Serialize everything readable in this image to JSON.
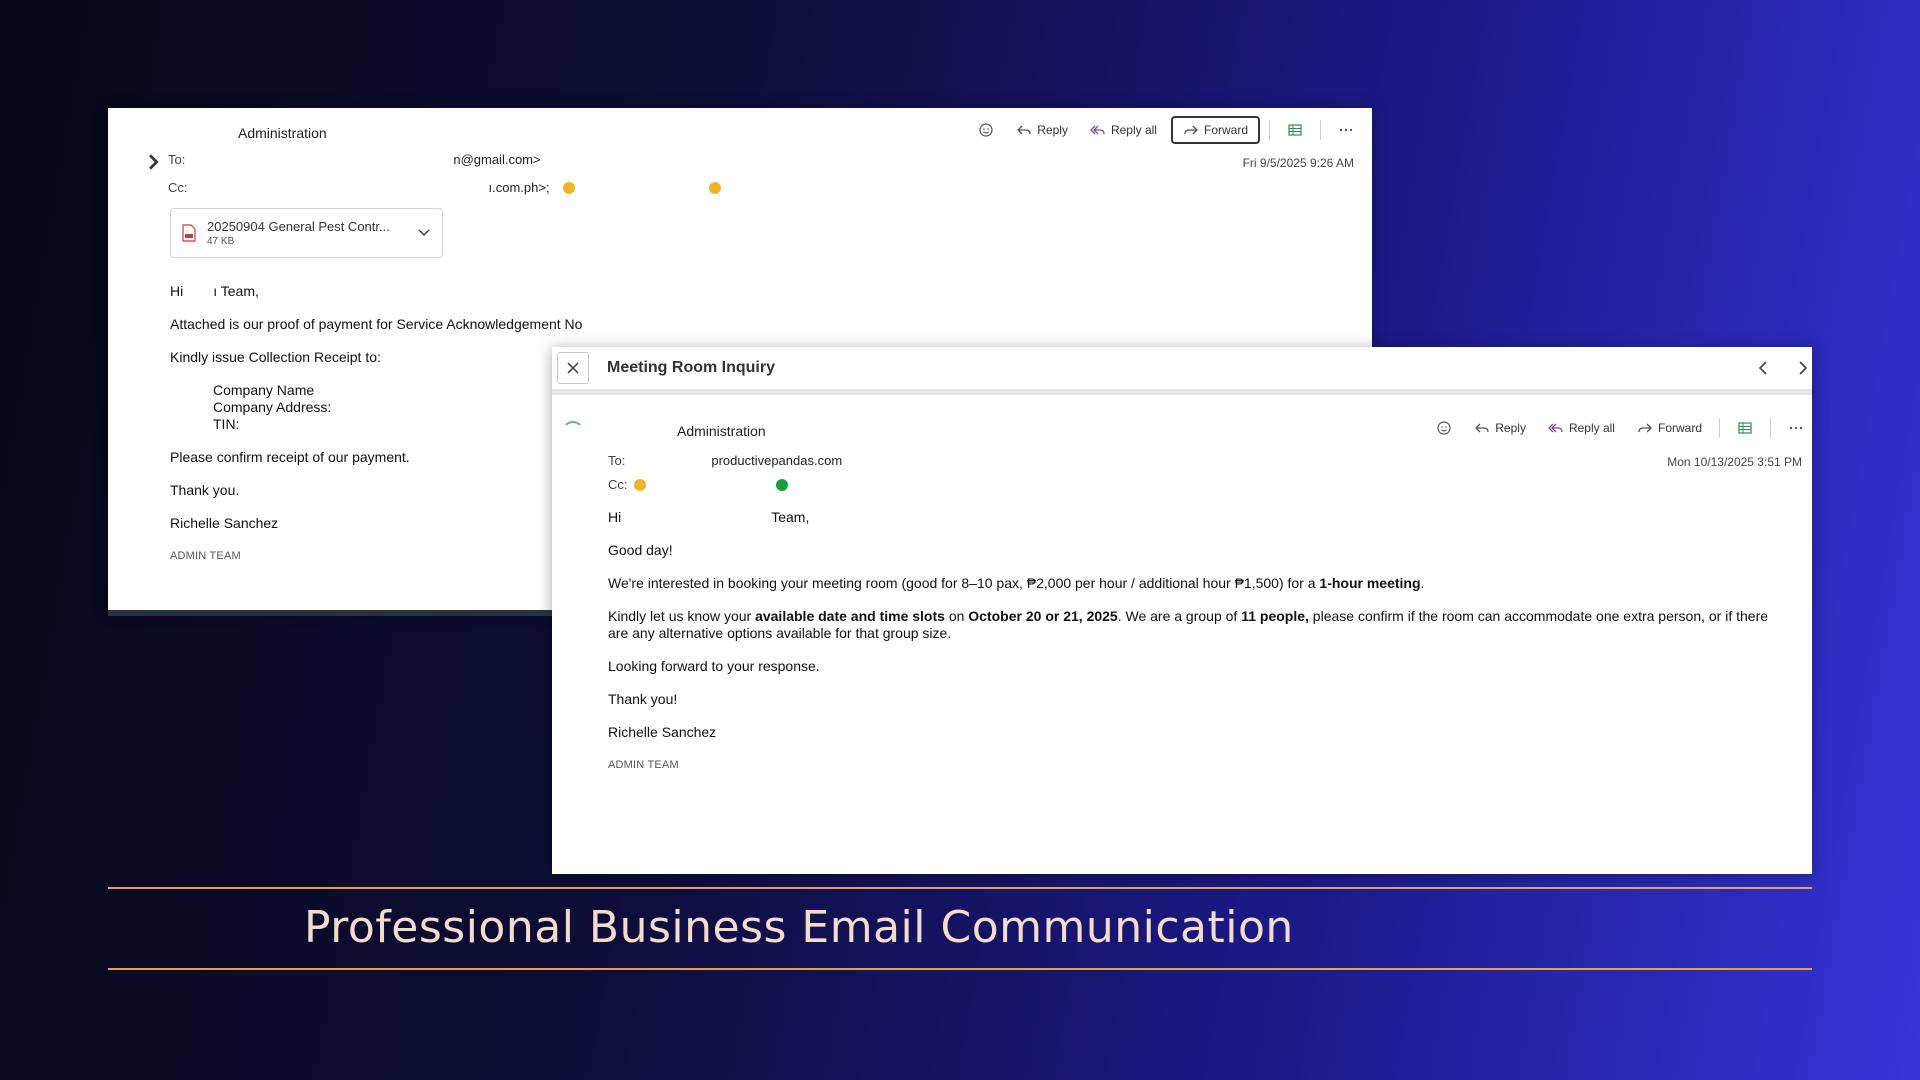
{
  "caption": "Professional Business Email Communication",
  "toolbar": {
    "reply": "Reply",
    "reply_all": "Reply all",
    "forward": "Forward",
    "icons": [
      "smiley-icon",
      "reply-icon",
      "reply-all-icon",
      "forward-icon",
      "table-icon",
      "more-icon"
    ]
  },
  "email1": {
    "sender": "Administration",
    "to_label": "To:",
    "to_value": "n@gmail.com>",
    "cc_label": "Cc:",
    "cc_value": "ı.com.ph>;",
    "timestamp": "Fri 9/5/2025 9:26 AM",
    "attachment": {
      "name": "20250904 General Pest Contr...",
      "size": "47 KB"
    },
    "body": {
      "greeting_pre": "Hi",
      "greeting_post": "ı Team,",
      "line1": "Attached is our proof of payment for Service Acknowledgement No",
      "line2": "Kindly issue Collection Receipt to:",
      "field_company_name": "Company Name",
      "field_company_address": "Company Address:",
      "field_tin": "TIN:",
      "line3": "Please confirm receipt of our payment.",
      "thanks": "Thank you.",
      "signature": "Richelle Sanchez",
      "team": "ADMIN TEAM"
    }
  },
  "email2": {
    "subject": "Meeting Room Inquiry",
    "sender": "Administration",
    "to_label": "To:",
    "to_value": "productivepandas.com",
    "cc_label": "Cc:",
    "timestamp": "Mon 10/13/2025 3:51 PM",
    "body": {
      "greeting_pre": "Hi",
      "greeting_post": "Team,",
      "good_day": "Good day!",
      "p1_a": "We're interested in booking your meeting room (good for 8–10 pax, ₱2,000 per hour / additional hour ₱1,500) for a ",
      "p1_b": "1-hour meeting",
      "p1_c": ".",
      "p2_a": "Kindly let us know your ",
      "p2_b": "available date and time slots",
      "p2_c": " on ",
      "p2_d": "October 20 or 21, 2025",
      "p2_e": ". We are a group of ",
      "p2_f": "11 people,",
      "p2_g": " please confirm if the room can accommodate one extra person, or if there are any alternative options available for that group size.",
      "looking": "Looking forward to your response.",
      "thanks": "Thank you!",
      "signature": "Richelle Sanchez",
      "team": "ADMIN TEAM"
    }
  },
  "colors": {
    "status_yellow": "#f0b429",
    "status_green": "#1a9e3a",
    "caption_rule": "#e0a055",
    "caption_text": "#f4dccc"
  }
}
